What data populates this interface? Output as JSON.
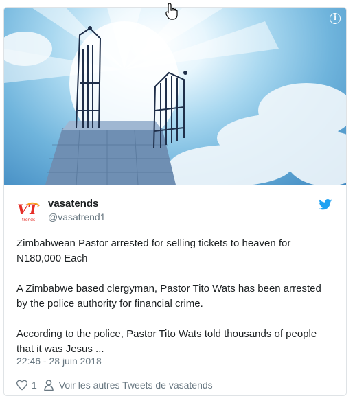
{
  "media": {
    "info_icon": "info-icon"
  },
  "tweet": {
    "display_name": "vasatends",
    "handle": "@vasatrend1",
    "avatar_text": "VT",
    "avatar_subtext": "trends",
    "paragraphs": [
      "Zimbabwean Pastor arrested for selling tickets to heaven for N180,000 Each",
      "A Zimbabwe based clergyman, Pastor Tito Wats has been arrested by the police authority for financial crime.",
      "According to the police, Pastor Tito Wats told thousands of people that it was Jesus ..."
    ],
    "timestamp": "22:46 - 28 juin 2018",
    "like_count": "1",
    "see_more_label": "Voir les autres Tweets de vasatends"
  },
  "colors": {
    "accent": "#1da1f2",
    "text": "#1c2022",
    "muted": "#697882"
  }
}
